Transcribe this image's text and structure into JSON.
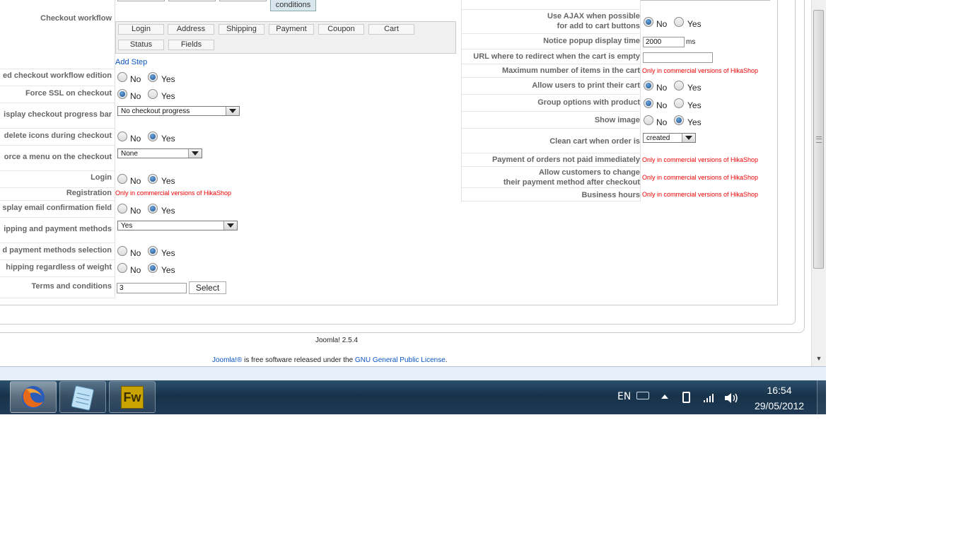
{
  "left_settings": {
    "checkout_workflow_label": "Checkout workflow",
    "workflow_steps_row1": [
      "Login",
      "Address",
      "Shipping",
      "Payment",
      "Coupon",
      "Cart"
    ],
    "workflow_steps_row2": [
      "Status",
      "Fields"
    ],
    "conditions_button": "conditions",
    "add_step_link": "Add Step",
    "rows": [
      {
        "label": "ed checkout workflow edition",
        "type": "radio",
        "value": "Yes"
      },
      {
        "label": "Force SSL on checkout",
        "type": "radio",
        "value": "No"
      },
      {
        "label": "isplay checkout progress bar",
        "type": "select",
        "value": "No checkout progress"
      },
      {
        "label": "delete icons during checkout",
        "type": "radio",
        "value": "Yes"
      },
      {
        "label": "orce a menu on the checkout",
        "type": "select",
        "value": "None"
      },
      {
        "label": "Login",
        "type": "radio",
        "value": "Yes"
      },
      {
        "label": "Registration",
        "type": "commercial"
      },
      {
        "label": "splay email confirmation field",
        "type": "radio",
        "value": "Yes"
      },
      {
        "label": "ipping and payment methods",
        "type": "select",
        "value": "Yes"
      },
      {
        "label": "d payment methods selection",
        "type": "radio",
        "value": "Yes"
      },
      {
        "label": "hipping regardless of weight",
        "type": "radio",
        "value": "Yes"
      },
      {
        "label": "Terms and conditions",
        "type": "input_select",
        "value": "3",
        "button": "Select"
      }
    ]
  },
  "right_settings": {
    "rows": [
      {
        "label": "Use AJAX when possible",
        "label2": "for add to cart buttons",
        "type": "radio",
        "value": "No"
      },
      {
        "label": "Notice popup display time",
        "type": "input_unit",
        "value": "2000",
        "unit": "ms"
      },
      {
        "label": "URL where to redirect when the cart is empty",
        "type": "input",
        "value": ""
      },
      {
        "label": "Maximum number of items in the cart",
        "type": "commercial"
      },
      {
        "label": "Allow users to print their cart",
        "type": "radio",
        "value": "No"
      },
      {
        "label": "Group options with product",
        "type": "radio",
        "value": "No"
      },
      {
        "label": "Show image",
        "type": "radio",
        "value": "Yes"
      },
      {
        "label": "Clean cart when order is",
        "type": "select",
        "value": "created"
      },
      {
        "label": "Payment of orders not paid immediately",
        "type": "commercial"
      },
      {
        "label": "Allow customers to change",
        "label2": "their payment method after checkout",
        "type": "commercial"
      },
      {
        "label": "Business hours",
        "type": "commercial"
      }
    ]
  },
  "common": {
    "no": "No",
    "yes": "Yes",
    "commercial_note": "Only in commercial versions of HikaShop"
  },
  "footer": {
    "version": "Joomla! 2.5.4",
    "license_brand": "Joomla!®",
    "license_middle": " is free software released under the ",
    "license_link": "GNU General Public License",
    "license_end": "."
  },
  "taskbar": {
    "apps": [
      {
        "icon": "firefox-icon",
        "label": "Firefox"
      },
      {
        "icon": "notepad-icon",
        "label": "Notepad"
      },
      {
        "icon": "fireworks-icon",
        "label": "Fw"
      }
    ],
    "language": "EN",
    "time": "16:54",
    "date": "29/05/2012"
  },
  "colors": {
    "label": "#666666",
    "link": "#0b55c4",
    "commercial": "#ee0000",
    "taskbar": "#1f3a55"
  }
}
